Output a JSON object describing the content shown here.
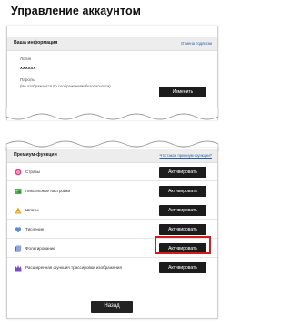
{
  "page": {
    "title": "Управление аккаунтом",
    "back_label": "Назад"
  },
  "account": {
    "section_title": "Ваша информация",
    "section_link": "Отмена подписки",
    "login_label": "Логин",
    "login_value": "xxxxxx",
    "password_label": "Пароль",
    "password_note": "(Не отображается по соображениям безопасности)",
    "change_label": "Изменить"
  },
  "premium": {
    "section_title": "Премиум-функции",
    "section_link": "Что такое премиум-функции?",
    "items": [
      {
        "label": "Стразы",
        "button": "Активировать",
        "icon": "gem-icon",
        "color": "#e0408a"
      },
      {
        "label": "Пиксельные настройки",
        "button": "Активировать",
        "icon": "pixel-brush-icon",
        "color": "#4caf50"
      },
      {
        "label": "Шпаты",
        "button": "Активировать",
        "icon": "paint-icon",
        "color": "#e8a21a"
      },
      {
        "label": "Тиснение",
        "button": "Активировать",
        "icon": "heart-icon",
        "color": "#5b8fd6"
      },
      {
        "label": "Фольгирование",
        "button": "Активировать",
        "icon": "foil-icon",
        "color": "#5068b8"
      },
      {
        "label": "Расширенная функция трассировки изображения",
        "button": "Активировать",
        "icon": "crown-icon",
        "color": "#7a4fc2"
      }
    ],
    "highlighted_index": 4,
    "highlight_color": "#d61a1a"
  }
}
